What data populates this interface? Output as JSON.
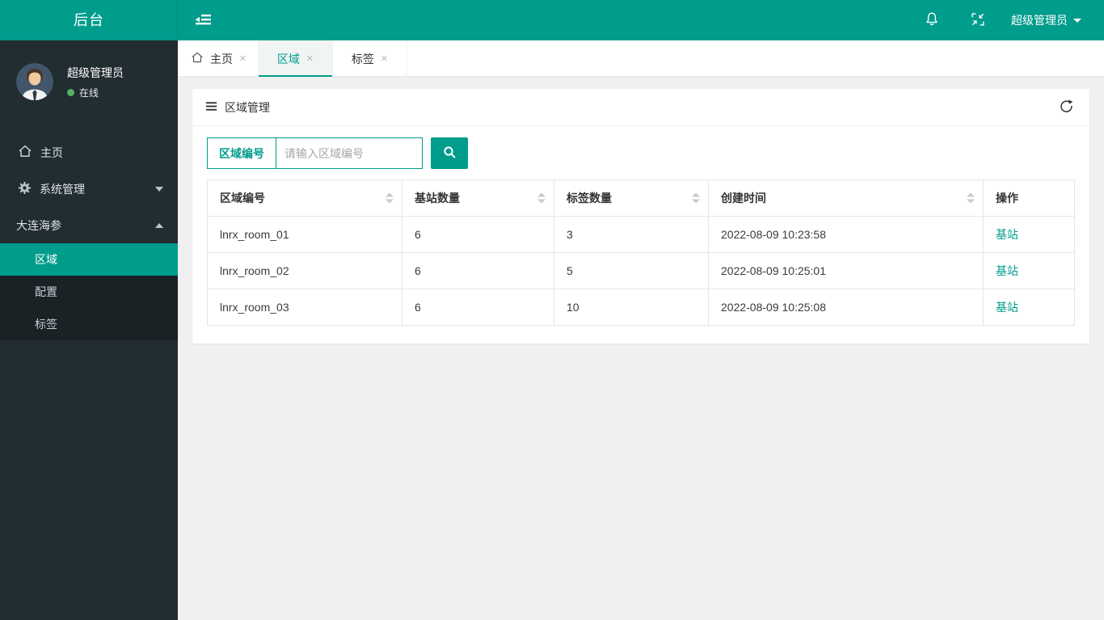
{
  "colors": {
    "accent": "#009c8c",
    "sidebar_bg": "#222d32",
    "submenu_bg": "#1a2226",
    "content_bg": "#f0f0f0",
    "status_online_green": "#54b35f"
  },
  "glyphs": {
    "close": "×"
  },
  "header": {
    "brand": "后台",
    "icons": [
      "shrink-toggle-icon",
      "bell-icon",
      "screen-restore-icon"
    ],
    "user_menu": {
      "label": "超级管理员"
    }
  },
  "sidebar": {
    "user": {
      "name": "超级管理员",
      "status": "在线"
    },
    "menu": [
      {
        "label": "主页",
        "icon": "home-icon"
      },
      {
        "label": "系统管理",
        "icon": "gear-icon",
        "expander": "down"
      },
      {
        "label": "大连海参",
        "expander": "up"
      }
    ],
    "submenu": [
      {
        "label": "区域",
        "active": true
      },
      {
        "label": "配置",
        "active": false
      },
      {
        "label": "标签",
        "active": false
      }
    ]
  },
  "tabs": [
    {
      "label": "主页",
      "icon": "home-icon",
      "active": false
    },
    {
      "label": "区域",
      "active": true
    },
    {
      "label": "标签",
      "active": false
    }
  ],
  "panel": {
    "title": "区域管理",
    "search": {
      "field_label": "区域编号",
      "placeholder": "请输入区域编号"
    },
    "table": {
      "columns": [
        {
          "label": "区域编号",
          "sortable": true
        },
        {
          "label": "基站数量",
          "sortable": true
        },
        {
          "label": "标签数量",
          "sortable": true
        },
        {
          "label": "创建时间",
          "sortable": true
        },
        {
          "label": "操作",
          "sortable": false
        }
      ],
      "rows": [
        {
          "region": "lnrx_room_01",
          "stations": "6",
          "tags": "3",
          "created": "2022-08-09 10:23:58",
          "action": "基站"
        },
        {
          "region": "lnrx_room_02",
          "stations": "6",
          "tags": "5",
          "created": "2022-08-09 10:25:01",
          "action": "基站"
        },
        {
          "region": "lnrx_room_03",
          "stations": "6",
          "tags": "10",
          "created": "2022-08-09 10:25:08",
          "action": "基站"
        }
      ]
    }
  }
}
